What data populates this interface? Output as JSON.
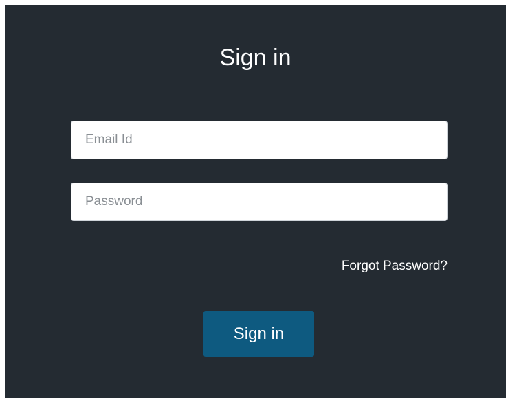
{
  "form": {
    "title": "Sign in",
    "email": {
      "placeholder": "Email Id",
      "value": ""
    },
    "password": {
      "placeholder": "Password",
      "value": ""
    },
    "forgot_label": "Forgot Password?",
    "submit_label": "Sign in"
  },
  "colors": {
    "panel_background": "#242b32",
    "button_background": "#0e5a80",
    "text": "#ffffff"
  }
}
